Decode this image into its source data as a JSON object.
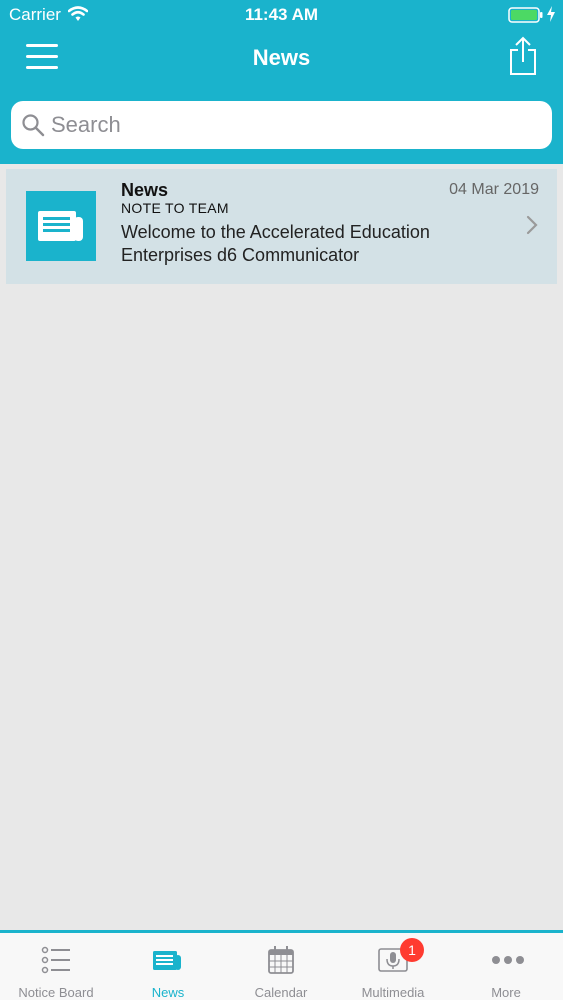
{
  "status_bar": {
    "carrier": "Carrier",
    "time": "11:43 AM"
  },
  "nav": {
    "title": "News"
  },
  "search": {
    "placeholder": "Search"
  },
  "news_items": [
    {
      "title": "News",
      "date": "04 Mar 2019",
      "category": "NOTE TO TEAM",
      "summary": "Welcome to the Accelerated Education Enterprises d6 Communicator"
    }
  ],
  "tabs": [
    {
      "label": "Notice Board",
      "icon": "list-icon"
    },
    {
      "label": "News",
      "icon": "newspaper-icon",
      "active": true
    },
    {
      "label": "Calendar",
      "icon": "calendar-icon"
    },
    {
      "label": "Multimedia",
      "icon": "microphone-icon",
      "badge": "1"
    },
    {
      "label": "More",
      "icon": "more-dots-icon"
    }
  ],
  "colors": {
    "accent": "#1ab3cc",
    "background": "#e8e8e8",
    "row_background": "#d3e1e6",
    "badge": "#ff3b30"
  }
}
